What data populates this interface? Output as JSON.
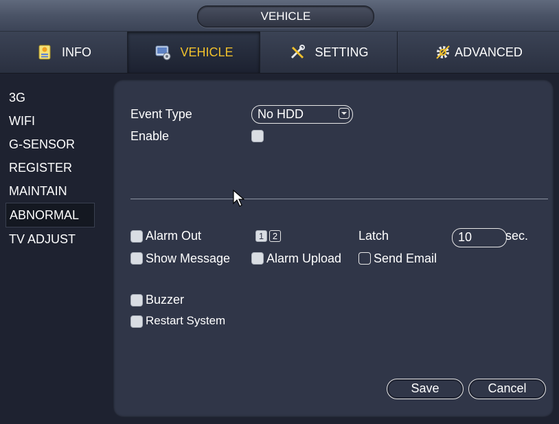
{
  "window": {
    "title": "VEHICLE"
  },
  "tabs": [
    {
      "label": "INFO",
      "icon": "info-icon",
      "active": false
    },
    {
      "label": "VEHICLE",
      "icon": "vehicle-icon",
      "active": true
    },
    {
      "label": "SETTING",
      "icon": "setting-icon",
      "active": false
    },
    {
      "label": "ADVANCED",
      "icon": "advanced-icon",
      "active": false
    }
  ],
  "sidebar": {
    "items": [
      {
        "label": "3G"
      },
      {
        "label": "WIFI"
      },
      {
        "label": "G-SENSOR"
      },
      {
        "label": "REGISTER"
      },
      {
        "label": "MAINTAIN"
      },
      {
        "label": "ABNORMAL",
        "active": true
      },
      {
        "label": "TV ADJUST"
      }
    ]
  },
  "form": {
    "event_type_label": "Event Type",
    "event_type_value": "No HDD",
    "enable_label": "Enable",
    "alarm_out_label": "Alarm Out",
    "alarm_out_channels": [
      "1",
      "2"
    ],
    "latch_label": "Latch",
    "latch_value": "10",
    "latch_unit": "sec.",
    "show_message_label": "Show Message",
    "alarm_upload_label": "Alarm Upload",
    "send_email_label": "Send Email",
    "buzzer_label": "Buzzer",
    "restart_system_label": "Restart System"
  },
  "buttons": {
    "save": "Save",
    "cancel": "Cancel"
  },
  "colors": {
    "active_tab_text": "#f0c02c",
    "panel_bg": "#303648",
    "page_bg": "#1e2230"
  }
}
